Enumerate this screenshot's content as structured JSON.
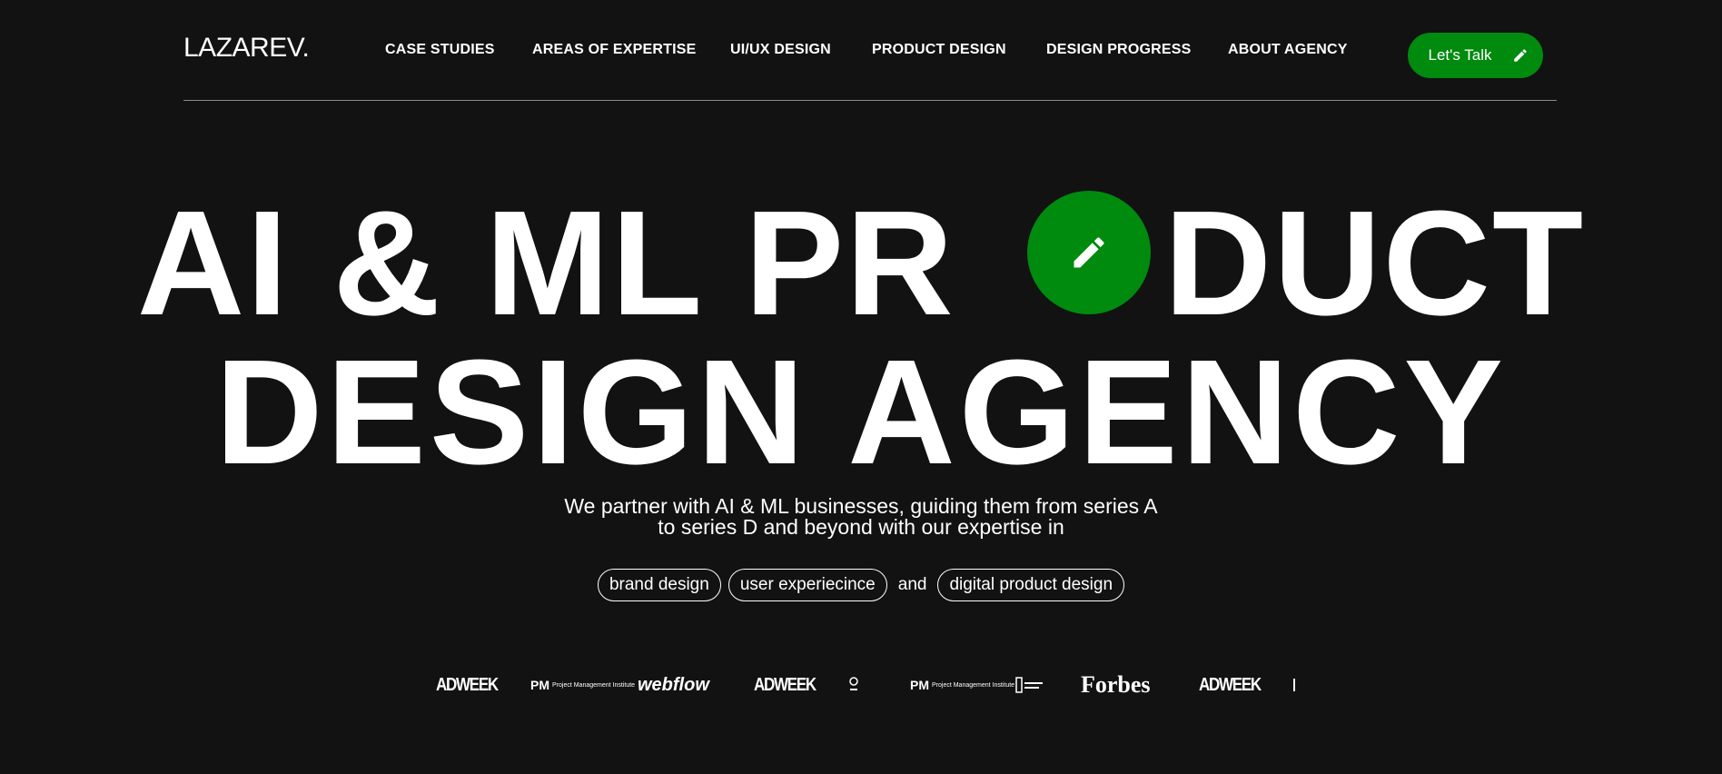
{
  "brand": {
    "logo": "LAZAREV."
  },
  "nav": {
    "items": [
      {
        "label": "CASE STUDIES"
      },
      {
        "label": "AREAS OF EXPERTISE"
      },
      {
        "label": "UI/UX DESIGN"
      },
      {
        "label": "PRODUCT DESIGN"
      },
      {
        "label": "DESIGN PROGRESS"
      },
      {
        "label": "ABOUT AGENCY"
      }
    ],
    "cta_label": "Let's Talk"
  },
  "hero": {
    "line1_left": "AI & ML PR",
    "line1_right": "DUCT",
    "line2": "DESIGN AGENCY",
    "subtitle_line1": "We partner with AI & ML businesses, guiding them from series A",
    "subtitle_line2": "to series D and beyond with our expertise in",
    "pills": [
      "brand design",
      "user experiecince",
      "digital product design"
    ],
    "connector": "and"
  },
  "logos": {
    "adweek": "ADWEEK",
    "webflow": "webflow",
    "forbes": "Forbes",
    "pmi_mark": "PM",
    "pmi_text": "Project Management Institute"
  },
  "colors": {
    "background": "#121212",
    "accent": "#008a0e",
    "text": "#ffffff"
  }
}
